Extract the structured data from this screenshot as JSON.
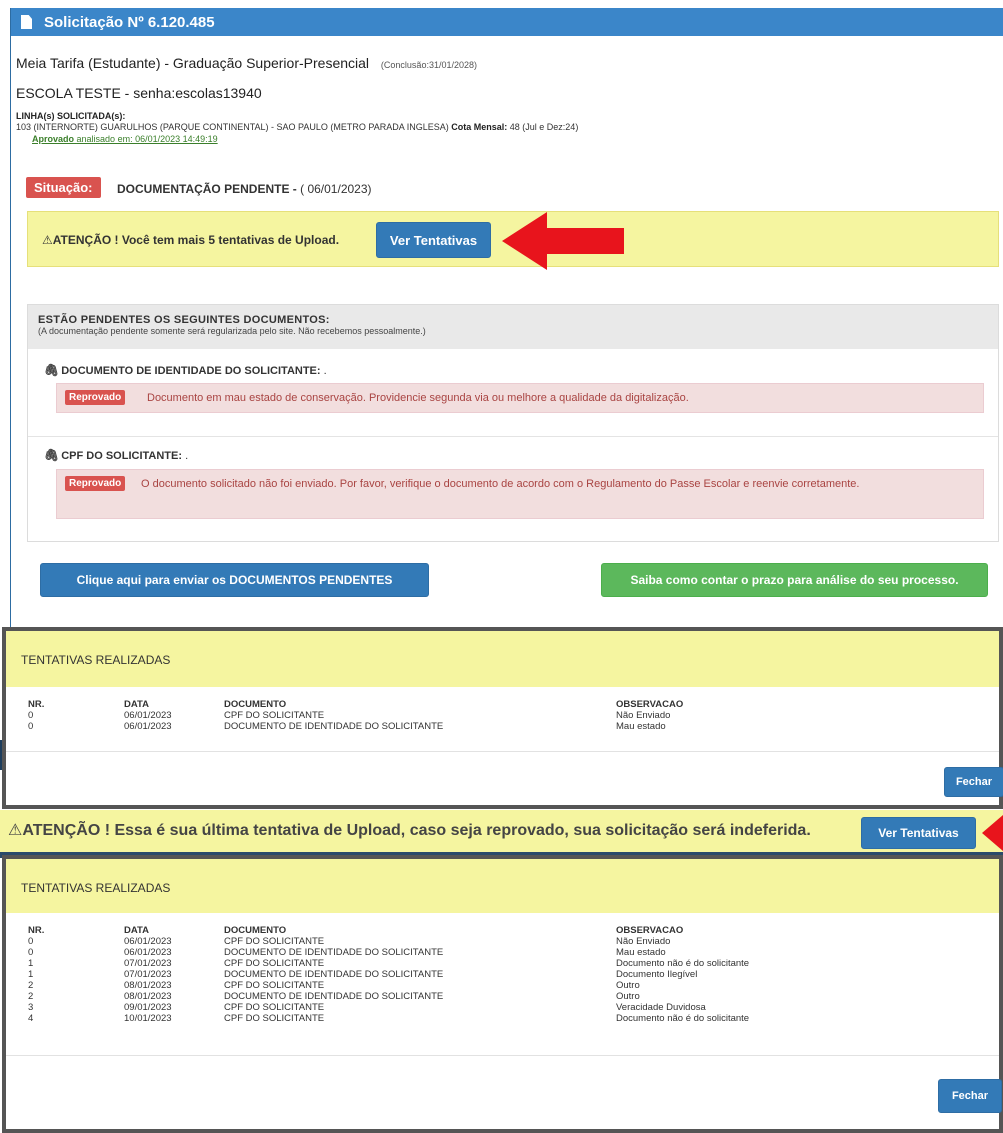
{
  "header": {
    "title": "Solicitação Nº 6.120.485"
  },
  "info": {
    "line1": "Meia Tarifa (Estudante) - Graduação Superior-Presencial",
    "conclusao": "(Conclusão:31/01/2028)",
    "escola": "ESCOLA TESTE - senha:escolas13940",
    "linha_label": "LINHA(s) SOLICITADA(s):",
    "linha_text": "103 (INTERNORTE) GUARULHOS (PARQUE CONTINENTAL) - SAO PAULO (METRO PARADA INGLESA)",
    "cota_label": "Cota Mensal:",
    "cota_value": "48 (Jul e Dez:24)",
    "aprovado_label": "Aprovado",
    "aprovado_text": "analisado em: 06/01/2023 14:49:19"
  },
  "situacao": {
    "label": "Situação:",
    "status": "DOCUMENTAÇÃO PENDENTE - ",
    "date": "( 06/01/2023)"
  },
  "warning1": {
    "text": "⚠ATENÇÃO ! Você tem mais 5 tentativas de Upload.",
    "button": "Ver Tentativas"
  },
  "pendentes": {
    "title": "ESTÃO PENDENTES OS SEGUINTES DOCUMENTOS:",
    "subtitle": "(A documentação pendente somente será regularizada pelo site. Não recebemos pessoalmente.)",
    "docs": [
      {
        "title": "DOCUMENTO DE IDENTIDADE DO SOLICITANTE:",
        "suffix": " .",
        "badge": "Reprovado",
        "message": "Documento em mau estado de conservação. Providencie segunda via ou melhore a qualidade da digitalização."
      },
      {
        "title": "CPF DO SOLICITANTE:",
        "suffix": " .",
        "badge": "Reprovado",
        "message": "O documento solicitado não foi enviado. Por favor, verifique o documento de acordo com o Regulamento do Passe Escolar e reenvie corretamente."
      }
    ]
  },
  "actions": {
    "enviar": "Clique aqui para enviar os DOCUMENTOS PENDENTES",
    "saiba": "Saiba como contar o prazo para análise do seu processo."
  },
  "modal1": {
    "title": "TENTATIVAS REALIZADAS",
    "columns": [
      "NR.",
      "DATA",
      "DOCUMENTO",
      "OBSERVACAO"
    ],
    "rows": [
      [
        "0",
        "06/01/2023",
        "CPF DO SOLICITANTE",
        "Não Enviado"
      ],
      [
        "0",
        "06/01/2023",
        "DOCUMENTO DE IDENTIDADE DO SOLICITANTE",
        "Mau estado"
      ]
    ],
    "close": "Fechar"
  },
  "warning2": {
    "text": "⚠ATENÇÃO ! Essa é sua última tentativa de Upload, caso seja reprovado, sua solicitação será indeferida.",
    "button": "Ver Tentativas"
  },
  "modal2": {
    "title": "TENTATIVAS REALIZADAS",
    "columns": [
      "NR.",
      "DATA",
      "DOCUMENTO",
      "OBSERVACAO"
    ],
    "rows": [
      [
        "0",
        "06/01/2023",
        "CPF DO SOLICITANTE",
        "Não Enviado"
      ],
      [
        "0",
        "06/01/2023",
        "DOCUMENTO DE IDENTIDADE DO SOLICITANTE",
        "Mau estado"
      ],
      [
        "1",
        "07/01/2023",
        "CPF DO SOLICITANTE",
        "Documento não é do solicitante"
      ],
      [
        "1",
        "07/01/2023",
        "DOCUMENTO DE IDENTIDADE DO SOLICITANTE",
        "Documento Ilegível"
      ],
      [
        "2",
        "08/01/2023",
        "CPF DO SOLICITANTE",
        "Outro"
      ],
      [
        "2",
        "08/01/2023",
        "DOCUMENTO DE IDENTIDADE DO SOLICITANTE",
        "Outro"
      ],
      [
        "3",
        "09/01/2023",
        "CPF DO SOLICITANTE",
        "Veracidade Duvidosa"
      ],
      [
        "4",
        "10/01/2023",
        "CPF DO SOLICITANTE",
        "Documento não é do solicitante"
      ]
    ],
    "close": "Fechar"
  },
  "colors": {
    "header_blue": "#3b86c9",
    "button_blue": "#337ab7",
    "button_green": "#5cb85c",
    "danger_red": "#d9534f",
    "warning_yellow": "#f5f5a0",
    "arrow_red": "#e8141c"
  },
  "icons": {
    "header": "document-icon",
    "attachment": "paperclip-icon",
    "annotation": "red-arrow-icon"
  }
}
